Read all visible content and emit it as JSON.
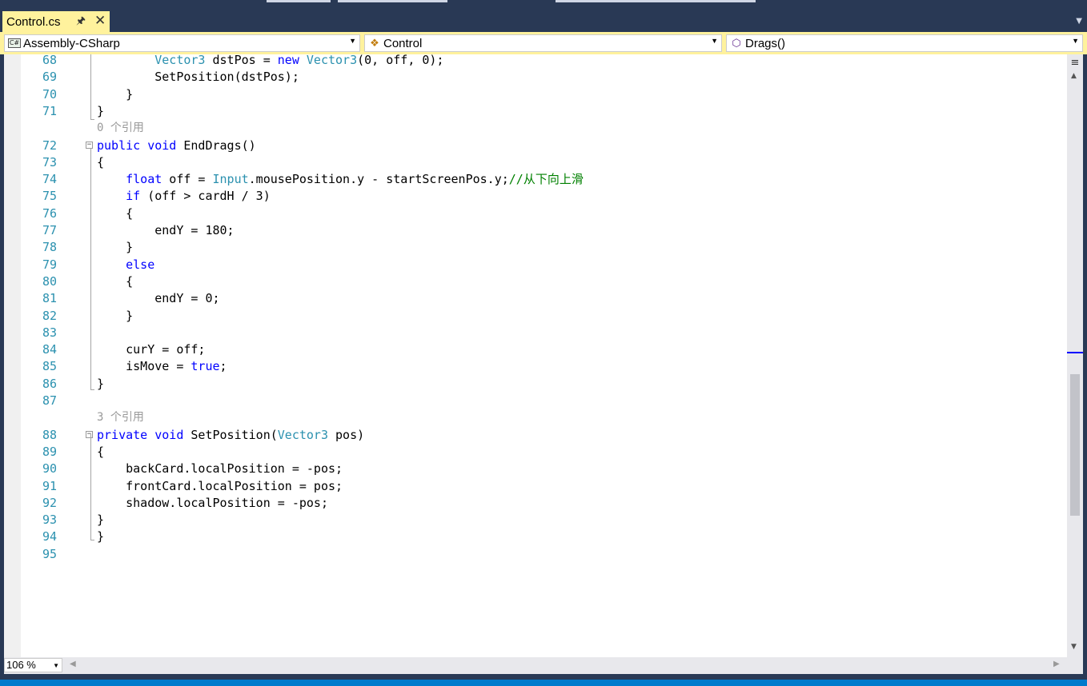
{
  "tab": {
    "title": "Control.cs",
    "pin_icon": "pin-icon",
    "close_icon": "close-icon"
  },
  "nav": {
    "project": {
      "label": "Assembly-CSharp",
      "icon": "csharp-project-icon"
    },
    "type": {
      "label": "Control",
      "icon": "class-icon"
    },
    "member": {
      "label": "Drags()",
      "icon": "method-cube-icon"
    }
  },
  "zoom": {
    "label": "106 %"
  },
  "colors": {
    "keyword": "#0000ff",
    "type": "#2b91af",
    "comment": "#008000",
    "line_number": "#2b91af",
    "tab_active": "#fff29d",
    "chrome": "#293955",
    "status": "#007acc"
  },
  "code_lines": [
    {
      "number": "68",
      "text": "            Vector3 dstPos = new Vector3(0, off, 0);"
    },
    {
      "number": "69",
      "text": "            SetPosition(dstPos);"
    },
    {
      "number": "70",
      "text": "        }"
    },
    {
      "number": "71",
      "text": "    }"
    },
    {
      "number": "",
      "text": "",
      "lens": "0 个引用"
    },
    {
      "number": "72",
      "text": "    public void EndDrags()"
    },
    {
      "number": "73",
      "text": "    {"
    },
    {
      "number": "74",
      "text": "        float off = Input.mousePosition.y - startScreenPos.y;//从下向上滑"
    },
    {
      "number": "75",
      "text": "        if (off > cardH / 3)"
    },
    {
      "number": "76",
      "text": "        {"
    },
    {
      "number": "77",
      "text": "            endY = 180;"
    },
    {
      "number": "78",
      "text": "        }"
    },
    {
      "number": "79",
      "text": "        else"
    },
    {
      "number": "80",
      "text": "        {"
    },
    {
      "number": "81",
      "text": "            endY = 0;"
    },
    {
      "number": "82",
      "text": "        }"
    },
    {
      "number": "83",
      "text": ""
    },
    {
      "number": "84",
      "text": "        curY = off;"
    },
    {
      "number": "85",
      "text": "        isMove = true;"
    },
    {
      "number": "86",
      "text": "    }"
    },
    {
      "number": "87",
      "text": ""
    },
    {
      "number": "",
      "text": "",
      "lens": "3 个引用"
    },
    {
      "number": "88",
      "text": "    private void SetPosition(Vector3 pos)"
    },
    {
      "number": "89",
      "text": "    {"
    },
    {
      "number": "90",
      "text": "        backCard.localPosition = -pos;"
    },
    {
      "number": "91",
      "text": "        frontCard.localPosition = pos;"
    },
    {
      "number": "92",
      "text": "        shadow.localPosition = -pos;"
    },
    {
      "number": "93",
      "text": "    }"
    },
    {
      "number": "94",
      "text": "}"
    },
    {
      "number": "95",
      "text": ""
    }
  ]
}
